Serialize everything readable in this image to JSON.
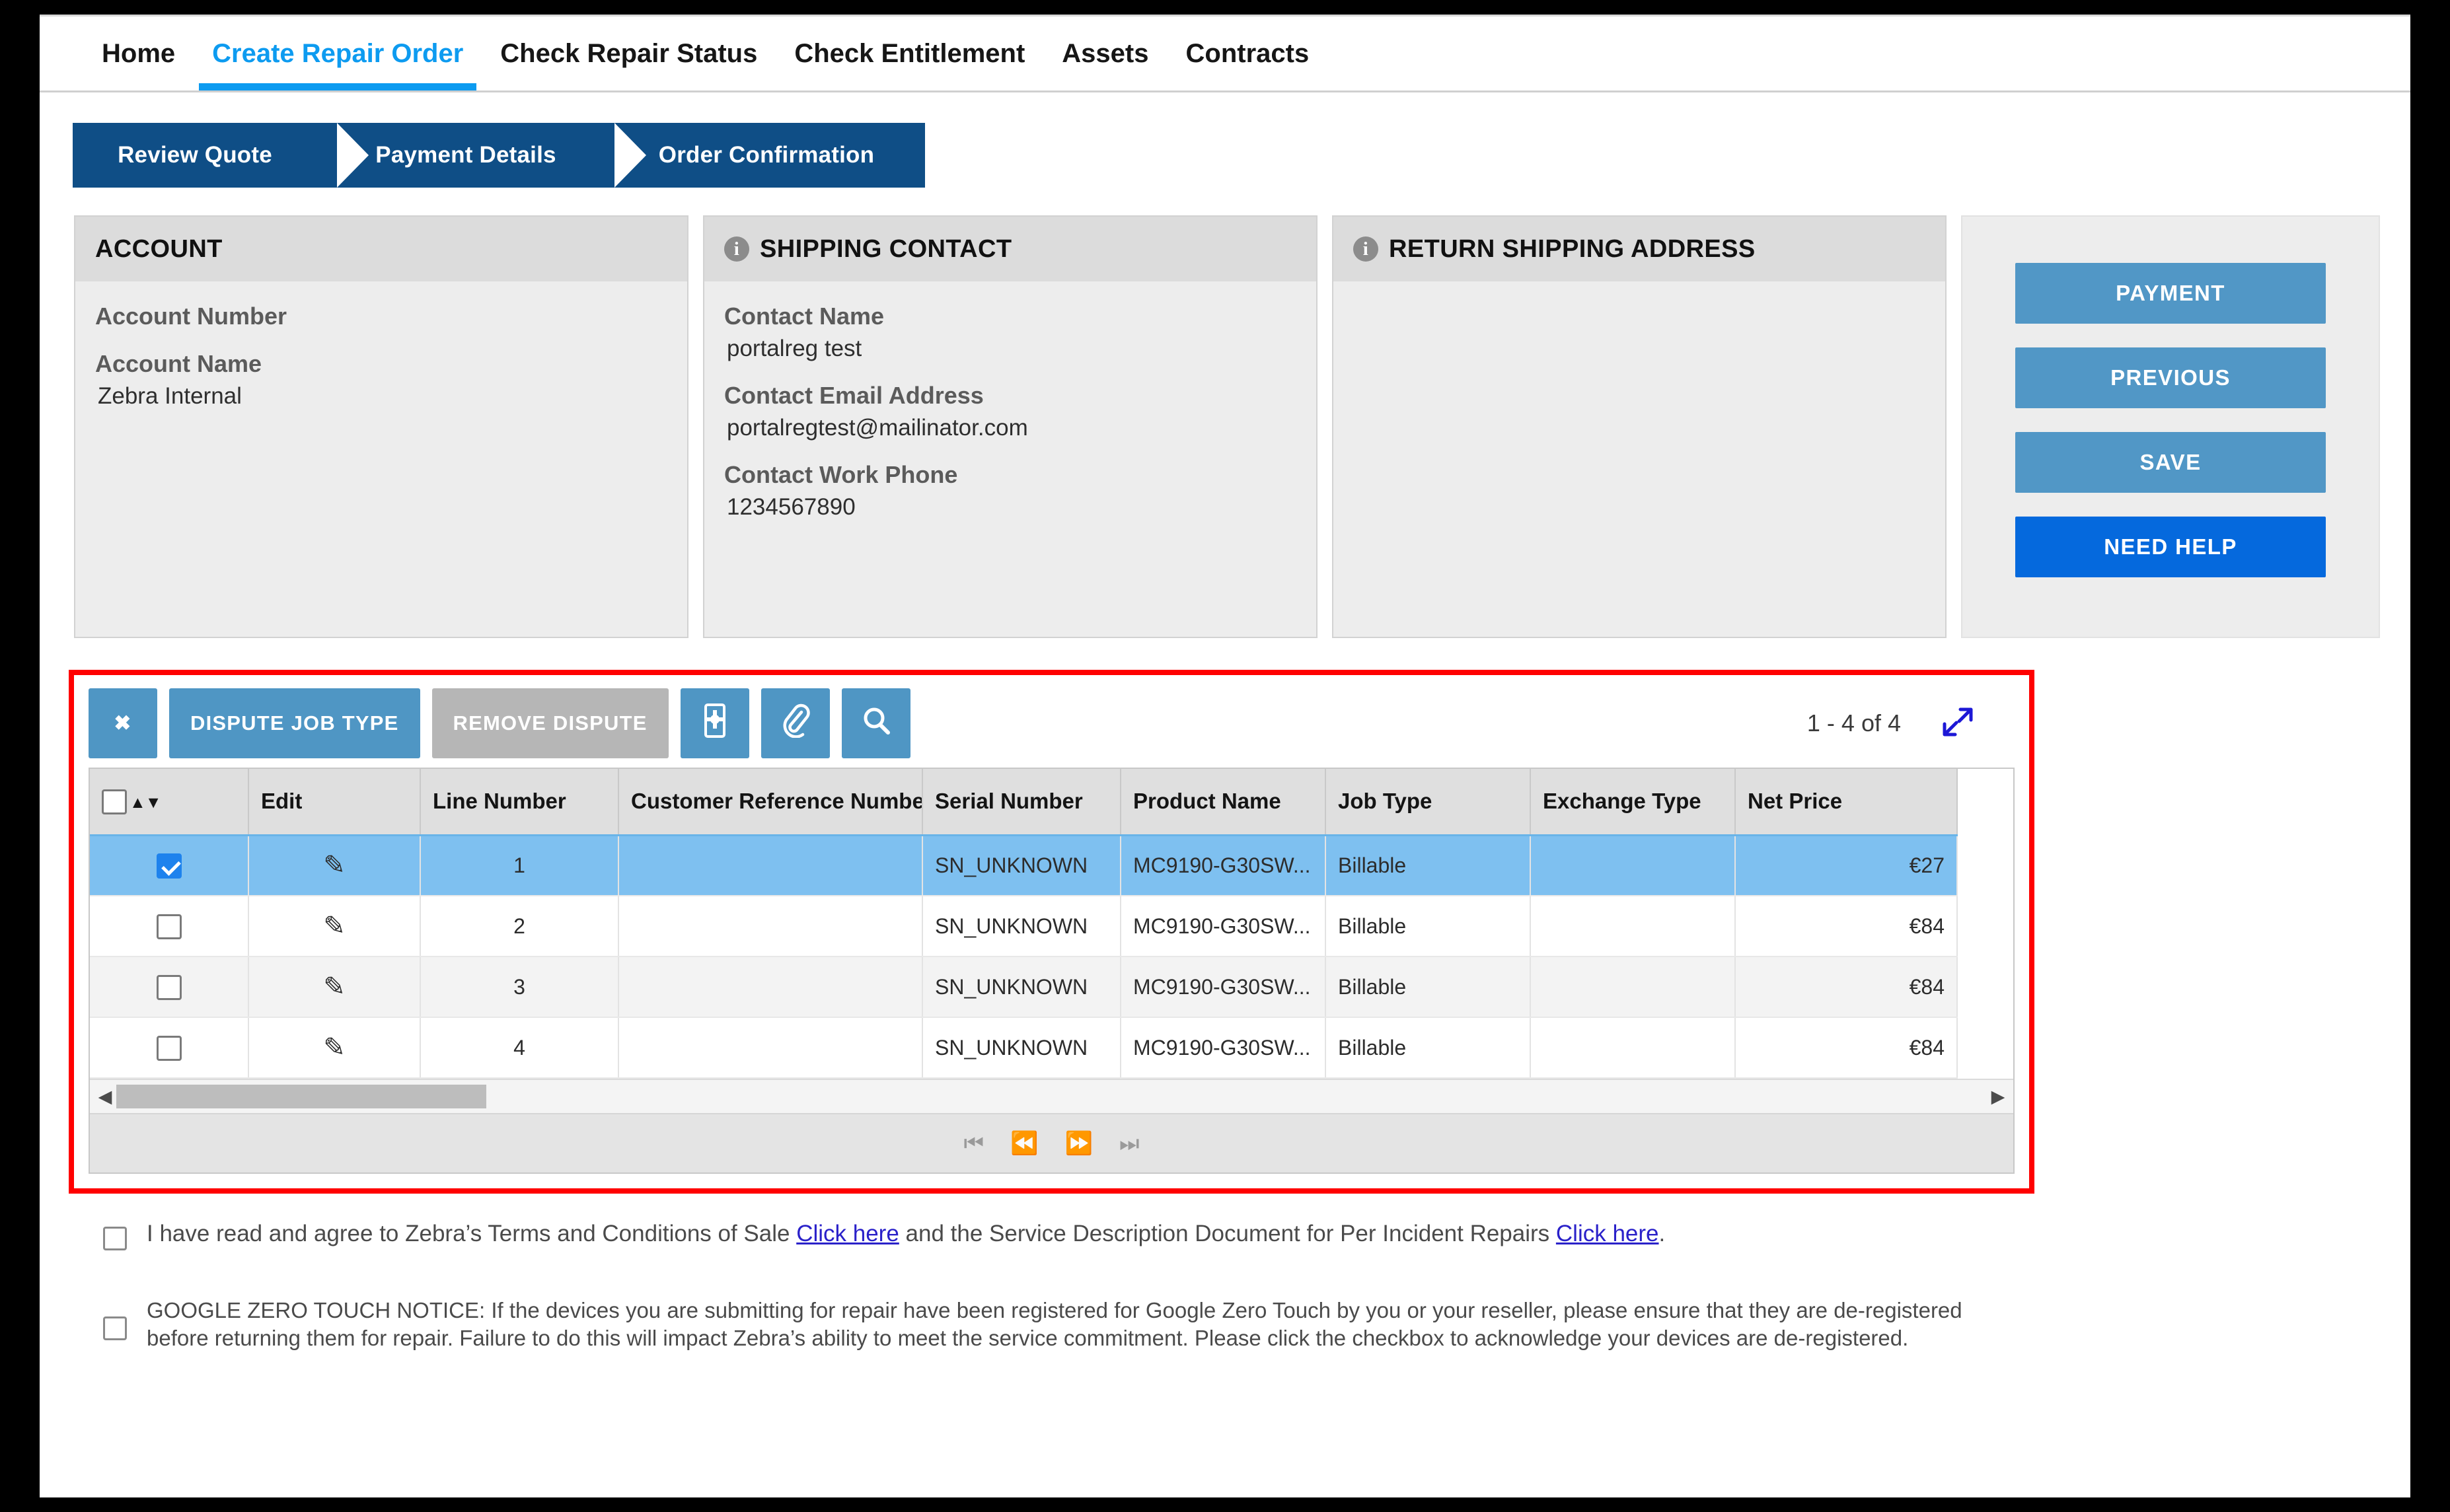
{
  "nav": {
    "items": [
      {
        "label": "Home",
        "active": false
      },
      {
        "label": "Create Repair Order",
        "active": true
      },
      {
        "label": "Check Repair Status",
        "active": false
      },
      {
        "label": "Check Entitlement",
        "active": false
      },
      {
        "label": "Assets",
        "active": false
      },
      {
        "label": "Contracts",
        "active": false
      }
    ]
  },
  "wizard": {
    "steps": [
      {
        "label": "Review Quote"
      },
      {
        "label": "Payment Details"
      },
      {
        "label": "Order Confirmation"
      }
    ]
  },
  "panels": {
    "account": {
      "title": "ACCOUNT",
      "fields": [
        {
          "label": "Account Number",
          "value": ""
        },
        {
          "label": "Account Name",
          "value": "Zebra Internal"
        }
      ]
    },
    "shipping_contact": {
      "title": "SHIPPING CONTACT",
      "icon": "info-icon",
      "fields": [
        {
          "label": "Contact Name",
          "value": "portalreg test"
        },
        {
          "label": "Contact Email Address",
          "value": "portalregtest@mailinator.com"
        },
        {
          "label": "Contact Work Phone",
          "value": "1234567890"
        }
      ]
    },
    "return_shipping_address": {
      "title": "RETURN SHIPPING ADDRESS",
      "icon": "info-icon",
      "fields": []
    }
  },
  "actions": {
    "payment": "PAYMENT",
    "previous": "PREVIOUS",
    "save": "SAVE",
    "need_help": "NEED HELP"
  },
  "toolbar": {
    "close": "✖",
    "dispute_job_type": "DISPUTE JOB TYPE",
    "remove_dispute": "REMOVE DISPUTE",
    "device_icon": "device-settings-icon",
    "attachment_icon": "paperclip-icon",
    "search_icon": "search-icon",
    "record_count": "1 - 4 of 4",
    "expand": "⤡"
  },
  "grid": {
    "columns": [
      "",
      "Edit",
      "Line Number",
      "Customer Reference Number",
      "Serial Number",
      "Product Name",
      "Job Type",
      "Exchange Type",
      "Net Price"
    ],
    "rows": [
      {
        "selected": true,
        "checked": true,
        "line_number": "1",
        "customer_reference_number": "",
        "serial_number": "SN_UNKNOWN",
        "product_name": "MC9190-G30SW...",
        "job_type": "Billable",
        "exchange_type": "",
        "net_price": "€27"
      },
      {
        "selected": false,
        "checked": false,
        "line_number": "2",
        "customer_reference_number": "",
        "serial_number": "SN_UNKNOWN",
        "product_name": "MC9190-G30SW...",
        "job_type": "Billable",
        "exchange_type": "",
        "net_price": "€84"
      },
      {
        "selected": false,
        "checked": false,
        "line_number": "3",
        "customer_reference_number": "",
        "serial_number": "SN_UNKNOWN",
        "product_name": "MC9190-G30SW...",
        "job_type": "Billable",
        "exchange_type": "",
        "net_price": "€84"
      },
      {
        "selected": false,
        "checked": false,
        "line_number": "4",
        "customer_reference_number": "",
        "serial_number": "SN_UNKNOWN",
        "product_name": "MC9190-G30SW...",
        "job_type": "Billable",
        "exchange_type": "",
        "net_price": "€84"
      }
    ],
    "pager": {
      "first": "⏮",
      "prev": "⏪",
      "next": "⏩",
      "last": "⏭"
    }
  },
  "consent": {
    "terms": {
      "part1": "I have read and agree to Zebra’s Terms and Conditions of Sale ",
      "link1": "Click here",
      "part2": " and the Service Description Document for Per Incident Repairs ",
      "link2": "Click here",
      "part3": "."
    },
    "google_zero_touch": "GOOGLE ZERO TOUCH NOTICE: If the devices you are submitting for repair have been registered for Google Zero Touch by you or your reseller, please ensure that they are de-registered before returning them for repair. Failure to do this will impact Zebra’s ability to meet the service commitment. Please click the checkbox to acknowledge your devices are de-registered."
  },
  "colors": {
    "accent_blue": "#0d9bf0",
    "wizard_blue": "#0f4e86",
    "button_blue": "#5197c6",
    "primary_blue": "#0569dd",
    "row_selected": "#7ec0f0",
    "highlight_border": "#ff0000",
    "link": "#2a21c9"
  }
}
